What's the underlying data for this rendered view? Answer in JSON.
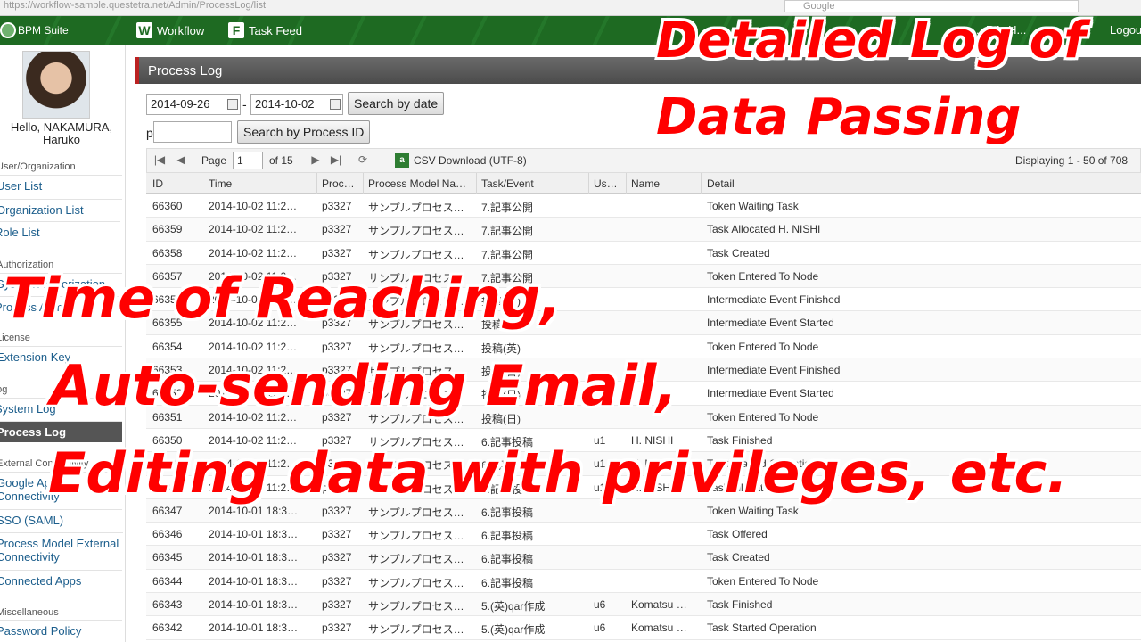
{
  "browser": {
    "url": "https://workflow-sample.questetra.net/Admin/ProcessLog/list",
    "search_placeholder": "Google"
  },
  "header": {
    "logo": "BPM Suite",
    "nav": [
      {
        "label": "Workflow",
        "icon": "W"
      },
      {
        "label": "Task Feed",
        "icon": "F"
      }
    ],
    "user_short": "...RA, H...",
    "logout": "Logout"
  },
  "sidebar": {
    "greeting": "Hello, NAKAMURA, Haruko",
    "categories": {
      "user_org": "User/Organization",
      "authorization": "Authorization",
      "license": "License",
      "log": "Log",
      "external": "External Connectivity",
      "misc": "Miscellaneous"
    },
    "items": {
      "user_list": "User List",
      "org_list": "Organization List",
      "role_list": "Role List",
      "system_authorization": "System Authorization",
      "process_admin": "Process Admin",
      "extension_key": "Extension Key",
      "system_log": "System Log",
      "process_log": "Process Log",
      "google_apps": "Google Apps Connectivity",
      "sso": "SSO (SAML)",
      "pm_external": "Process Model External Connectivity",
      "connected_apps": "Connected Apps",
      "password_policy": "Password Policy"
    }
  },
  "main": {
    "title": "Process Log",
    "date_from": "2014-09-26",
    "date_sep": "-",
    "date_to": "2014-10-02",
    "search_date_label": "Search by date",
    "pid_prefix": "p",
    "pid_value": "",
    "search_pid_label": "Search by Process ID",
    "pager": {
      "page_label": "Page",
      "page_value": "1",
      "of_pages": "of 15",
      "csv_label": "CSV Download (UTF-8)",
      "displaying": "Displaying 1 - 50 of 708"
    },
    "columns": [
      "ID",
      "Time",
      "Proc…",
      "Process Model Na…",
      "Task/Event",
      "Us…",
      "Name",
      "Detail"
    ],
    "rows": [
      [
        "66360",
        "2014-10-02 11:2…",
        "p3327",
        "サンプルプロセス…",
        "7.記事公開",
        "",
        "",
        "Token Waiting Task"
      ],
      [
        "66359",
        "2014-10-02 11:2…",
        "p3327",
        "サンプルプロセス…",
        "7.記事公開",
        "",
        "",
        "Task Allocated H. NISHI"
      ],
      [
        "66358",
        "2014-10-02 11:2…",
        "p3327",
        "サンプルプロセス…",
        "7.記事公開",
        "",
        "",
        "Task Created"
      ],
      [
        "66357",
        "2014-10-02 11:2…",
        "p3327",
        "サンプルプロセス…",
        "7.記事公開",
        "",
        "",
        "Token Entered To Node"
      ],
      [
        "66356",
        "2014-10-02 11:2…",
        "p3327",
        "サンプルプロセス…",
        "投稿(日)",
        "",
        "",
        "Intermediate Event Finished"
      ],
      [
        "66355",
        "2014-10-02 11:2…",
        "p3327",
        "サンプルプロセス…",
        "投稿(日)",
        "",
        "",
        "Intermediate Event Started"
      ],
      [
        "66354",
        "2014-10-02 11:2…",
        "p3327",
        "サンプルプロセス…",
        "投稿(英)",
        "",
        "",
        "Token Entered To Node"
      ],
      [
        "66353",
        "2014-10-02 11:2…",
        "p3327",
        "サンプルプロセス…",
        "投稿(日)",
        "",
        "",
        "Intermediate Event Finished"
      ],
      [
        "66352",
        "2014-10-02 11:2…",
        "p3327",
        "サンプルプロセス…",
        "投稿(日)",
        "",
        "",
        "Intermediate Event Started"
      ],
      [
        "66351",
        "2014-10-02 11:2…",
        "p3327",
        "サンプルプロセス…",
        "投稿(日)",
        "",
        "",
        "Token Entered To Node"
      ],
      [
        "66350",
        "2014-10-02 11:2…",
        "p3327",
        "サンプルプロセス…",
        "6.記事投稿",
        "u1",
        "H. NISHI",
        "Task Finished"
      ],
      [
        "66349",
        "2014-10-02 11:2…",
        "p3327",
        "サンプルプロセス…",
        "6.記事投稿",
        "u1",
        "H. NISHI",
        "Task Started Operation"
      ],
      [
        "66348",
        "2014-10-02 11:2…",
        "p3327",
        "サンプルプロセス…",
        "6.記事投稿",
        "u1",
        "H. NISHI",
        "Task Allocated"
      ],
      [
        "66347",
        "2014-10-01 18:3…",
        "p3327",
        "サンプルプロセス…",
        "6.記事投稿",
        "",
        "",
        "Token Waiting Task"
      ],
      [
        "66346",
        "2014-10-01 18:3…",
        "p3327",
        "サンプルプロセス…",
        "6.記事投稿",
        "",
        "",
        "Task Offered"
      ],
      [
        "66345",
        "2014-10-01 18:3…",
        "p3327",
        "サンプルプロセス…",
        "6.記事投稿",
        "",
        "",
        "Task Created"
      ],
      [
        "66344",
        "2014-10-01 18:3…",
        "p3327",
        "サンプルプロセス…",
        "6.記事投稿",
        "",
        "",
        "Token Entered To Node"
      ],
      [
        "66343",
        "2014-10-01 18:3…",
        "p3327",
        "サンプルプロセス…",
        "5.(英)qar作成",
        "u6",
        "Komatsu …",
        "Task Finished"
      ],
      [
        "66342",
        "2014-10-01 18:3…",
        "p3327",
        "サンプルプロセス…",
        "5.(英)qar作成",
        "u6",
        "Komatsu …",
        "Task Started Operation"
      ]
    ]
  },
  "captions": {
    "top_line1": "Detailed Log of",
    "top_line2": "Data Passing",
    "line1": "Time of Reaching,",
    "line2": "Auto-sending Email,",
    "line3": "Editing data with privileges, etc."
  },
  "colors": {
    "header_green": "#1e6a22",
    "caption_red": "#ff0000",
    "accent_bar": "#bb2222"
  }
}
